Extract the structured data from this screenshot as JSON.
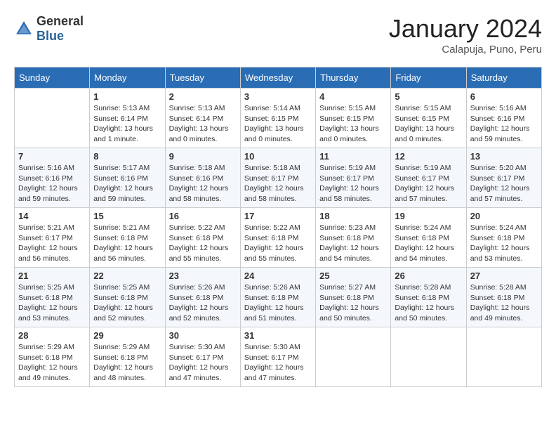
{
  "header": {
    "logo_general": "General",
    "logo_blue": "Blue",
    "month_year": "January 2024",
    "location": "Calapuja, Puno, Peru"
  },
  "days_of_week": [
    "Sunday",
    "Monday",
    "Tuesday",
    "Wednesday",
    "Thursday",
    "Friday",
    "Saturday"
  ],
  "weeks": [
    [
      {
        "day": "",
        "empty": true
      },
      {
        "day": "1",
        "sunrise": "5:13 AM",
        "sunset": "6:14 PM",
        "daylight": "13 hours and 1 minute."
      },
      {
        "day": "2",
        "sunrise": "5:13 AM",
        "sunset": "6:14 PM",
        "daylight": "13 hours and 0 minutes."
      },
      {
        "day": "3",
        "sunrise": "5:14 AM",
        "sunset": "6:15 PM",
        "daylight": "13 hours and 0 minutes."
      },
      {
        "day": "4",
        "sunrise": "5:15 AM",
        "sunset": "6:15 PM",
        "daylight": "13 hours and 0 minutes."
      },
      {
        "day": "5",
        "sunrise": "5:15 AM",
        "sunset": "6:15 PM",
        "daylight": "13 hours and 0 minutes."
      },
      {
        "day": "6",
        "sunrise": "5:16 AM",
        "sunset": "6:16 PM",
        "daylight": "12 hours and 59 minutes."
      }
    ],
    [
      {
        "day": "7",
        "sunrise": "5:16 AM",
        "sunset": "6:16 PM",
        "daylight": "12 hours and 59 minutes."
      },
      {
        "day": "8",
        "sunrise": "5:17 AM",
        "sunset": "6:16 PM",
        "daylight": "12 hours and 59 minutes."
      },
      {
        "day": "9",
        "sunrise": "5:18 AM",
        "sunset": "6:16 PM",
        "daylight": "12 hours and 58 minutes."
      },
      {
        "day": "10",
        "sunrise": "5:18 AM",
        "sunset": "6:17 PM",
        "daylight": "12 hours and 58 minutes."
      },
      {
        "day": "11",
        "sunrise": "5:19 AM",
        "sunset": "6:17 PM",
        "daylight": "12 hours and 58 minutes."
      },
      {
        "day": "12",
        "sunrise": "5:19 AM",
        "sunset": "6:17 PM",
        "daylight": "12 hours and 57 minutes."
      },
      {
        "day": "13",
        "sunrise": "5:20 AM",
        "sunset": "6:17 PM",
        "daylight": "12 hours and 57 minutes."
      }
    ],
    [
      {
        "day": "14",
        "sunrise": "5:21 AM",
        "sunset": "6:17 PM",
        "daylight": "12 hours and 56 minutes."
      },
      {
        "day": "15",
        "sunrise": "5:21 AM",
        "sunset": "6:18 PM",
        "daylight": "12 hours and 56 minutes."
      },
      {
        "day": "16",
        "sunrise": "5:22 AM",
        "sunset": "6:18 PM",
        "daylight": "12 hours and 55 minutes."
      },
      {
        "day": "17",
        "sunrise": "5:22 AM",
        "sunset": "6:18 PM",
        "daylight": "12 hours and 55 minutes."
      },
      {
        "day": "18",
        "sunrise": "5:23 AM",
        "sunset": "6:18 PM",
        "daylight": "12 hours and 54 minutes."
      },
      {
        "day": "19",
        "sunrise": "5:24 AM",
        "sunset": "6:18 PM",
        "daylight": "12 hours and 54 minutes."
      },
      {
        "day": "20",
        "sunrise": "5:24 AM",
        "sunset": "6:18 PM",
        "daylight": "12 hours and 53 minutes."
      }
    ],
    [
      {
        "day": "21",
        "sunrise": "5:25 AM",
        "sunset": "6:18 PM",
        "daylight": "12 hours and 53 minutes."
      },
      {
        "day": "22",
        "sunrise": "5:25 AM",
        "sunset": "6:18 PM",
        "daylight": "12 hours and 52 minutes."
      },
      {
        "day": "23",
        "sunrise": "5:26 AM",
        "sunset": "6:18 PM",
        "daylight": "12 hours and 52 minutes."
      },
      {
        "day": "24",
        "sunrise": "5:26 AM",
        "sunset": "6:18 PM",
        "daylight": "12 hours and 51 minutes."
      },
      {
        "day": "25",
        "sunrise": "5:27 AM",
        "sunset": "6:18 PM",
        "daylight": "12 hours and 50 minutes."
      },
      {
        "day": "26",
        "sunrise": "5:28 AM",
        "sunset": "6:18 PM",
        "daylight": "12 hours and 50 minutes."
      },
      {
        "day": "27",
        "sunrise": "5:28 AM",
        "sunset": "6:18 PM",
        "daylight": "12 hours and 49 minutes."
      }
    ],
    [
      {
        "day": "28",
        "sunrise": "5:29 AM",
        "sunset": "6:18 PM",
        "daylight": "12 hours and 49 minutes."
      },
      {
        "day": "29",
        "sunrise": "5:29 AM",
        "sunset": "6:18 PM",
        "daylight": "12 hours and 48 minutes."
      },
      {
        "day": "30",
        "sunrise": "5:30 AM",
        "sunset": "6:17 PM",
        "daylight": "12 hours and 47 minutes."
      },
      {
        "day": "31",
        "sunrise": "5:30 AM",
        "sunset": "6:17 PM",
        "daylight": "12 hours and 47 minutes."
      },
      {
        "day": "",
        "empty": true
      },
      {
        "day": "",
        "empty": true
      },
      {
        "day": "",
        "empty": true
      }
    ]
  ],
  "labels": {
    "sunrise": "Sunrise:",
    "sunset": "Sunset:",
    "daylight": "Daylight:"
  }
}
